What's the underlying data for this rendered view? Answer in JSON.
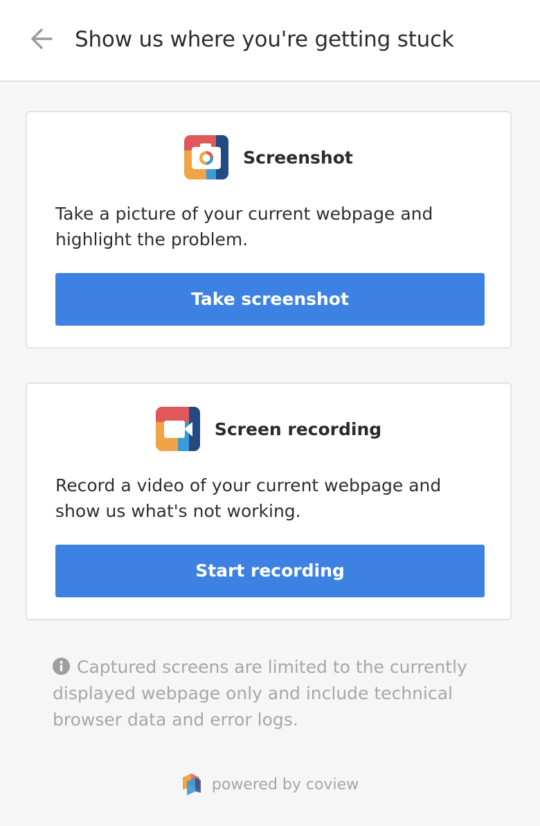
{
  "header": {
    "title": "Show us where you're getting stuck",
    "back_icon": "arrow-left-icon"
  },
  "cards": [
    {
      "icon": "camera-app-icon",
      "title": "Screenshot",
      "description": "Take a picture of your current webpage and highlight the problem.",
      "button_label": "Take screenshot"
    },
    {
      "icon": "video-camera-app-icon",
      "title": "Screen recording",
      "description": "Record a video of your current webpage and show us what's not working.",
      "button_label": "Start recording"
    }
  ],
  "disclaimer": {
    "icon": "info-icon",
    "text": "Captured screens are limited to the currently displayed webpage only and include technical browser data and error logs."
  },
  "footer": {
    "logo": "coview-logo-icon",
    "text": "powered by coview"
  },
  "colors": {
    "primary_button": "#3d82e3",
    "icon_red": "#e0585a",
    "icon_orange": "#f0a447",
    "icon_blue": "#3a9bd7",
    "icon_navy": "#234a82"
  }
}
